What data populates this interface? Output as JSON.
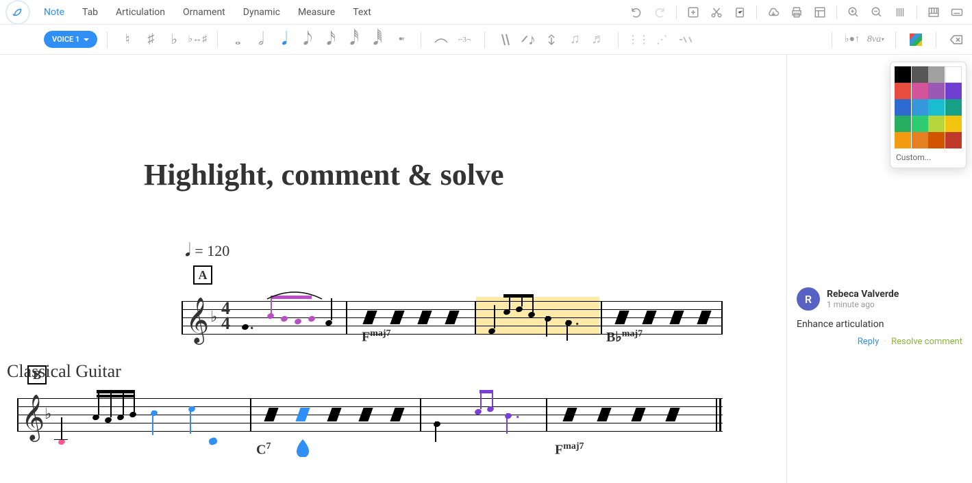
{
  "menu": {
    "items": [
      "Note",
      "Tab",
      "Articulation",
      "Ornament",
      "Dynamic",
      "Measure",
      "Text"
    ],
    "active": 0
  },
  "voice_btn": "VOICE 1",
  "score": {
    "title": "Highlight, comment & solve",
    "tempo_bpm": "= 120",
    "instrument": "Classical Guitar",
    "rehearsal_marks": [
      "A",
      "B"
    ],
    "chords_line1": [
      {
        "label": "F",
        "sup": "maj7"
      },
      {
        "label": "B♭",
        "sup": "maj7"
      }
    ],
    "chords_line2": [
      {
        "label": "C",
        "sup": "7"
      },
      {
        "label": "F",
        "sup": "maj7"
      }
    ],
    "time_sig_top": "4",
    "time_sig_bot": "4"
  },
  "color_popover": {
    "custom_label": "Custom...",
    "colors": [
      "#000000",
      "#575757",
      "#a0a0a0",
      "#ffffff",
      "#e74c3c",
      "#d35499",
      "#9b59b6",
      "#6f3fd1",
      "#2d6bd1",
      "#3498db",
      "#1abccf",
      "#16a085",
      "#27ae60",
      "#2ecc71",
      "#b6d53c",
      "#f1c40f",
      "#f39c12",
      "#e67e22",
      "#d35400",
      "#c0392b"
    ]
  },
  "comment": {
    "avatar_initial": "R",
    "author": "Rebeca Valverde",
    "time": "1 minute ago",
    "body": "Enhance articulation",
    "reply": "Reply",
    "resolve": "Resolve comment"
  }
}
